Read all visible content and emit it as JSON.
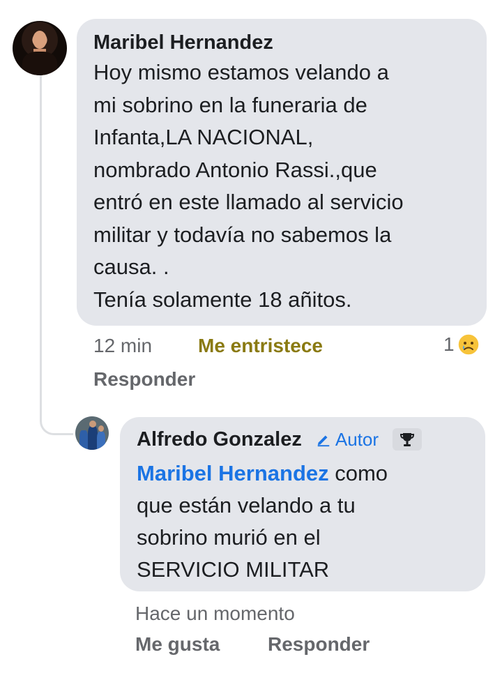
{
  "main_comment": {
    "author": "Maribel Hernandez",
    "lines": [
      "Hoy mismo estamos velando a",
      "mi sobrino en la funeraria de",
      "Infanta,LA NACIONAL,",
      "nombrado Antonio Rassi.,que",
      "entró en este llamado al servicio",
      "militar y todavía no sabemos la",
      "causa. .",
      "Tenía solamente 18 añitos."
    ],
    "time": "12 min",
    "reaction_label": "Me entristece",
    "reaction_count": "1",
    "reaction_icon": "sad-face-icon",
    "reply_label": "Responder"
  },
  "reply_comment": {
    "author": "Alfredo Gonzalez",
    "badge_label": "Autor",
    "badge_icon": "pencil-icon",
    "top_fan_icon": "trophy-icon",
    "mention": "Maribel Hernandez",
    "line1_rest": " como",
    "lines": [
      "que están velando a tu",
      "sobrino murió en el",
      "SERVICIO MILITAR"
    ],
    "time": "Hace un momento",
    "like_label": "Me gusta",
    "reply_label": "Responder"
  },
  "colors": {
    "bubble": "#e4e6eb",
    "meta_text": "#65676b",
    "link_blue": "#1b74e4",
    "sad_reaction": "#8a7a12"
  }
}
